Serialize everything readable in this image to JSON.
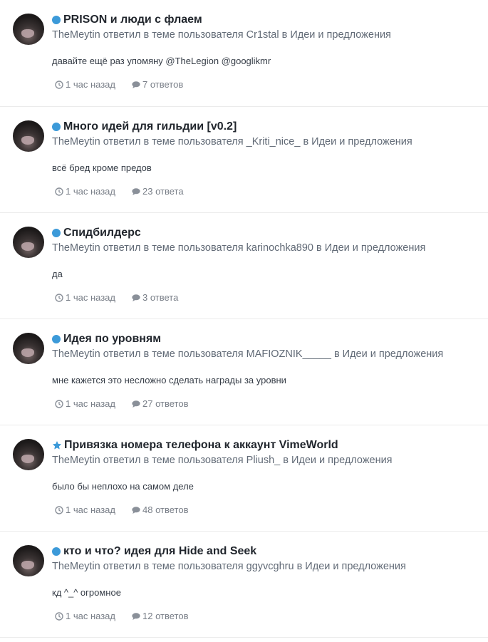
{
  "colors": {
    "unread_dot": "#3c9ad9",
    "title": "#21262d",
    "meta": "#616a76",
    "stats": "#787e87"
  },
  "entries": [
    {
      "marker": "dot",
      "title": "PRISON и люди с флаем",
      "meta": "TheMeytin ответил в теме пользователя Cr1stal в Идеи и предложения",
      "snippet": "давайте ещё раз упомяну @TheLegion @googlikmr",
      "time": "1 час назад",
      "replies": "7 ответов"
    },
    {
      "marker": "dot",
      "title": "Много идей для гильдии [v0.2]",
      "meta": "TheMeytin ответил в теме пользователя _Kriti_nice_ в Идеи и предложения",
      "snippet": "всё бред кроме предов",
      "time": "1 час назад",
      "replies": "23 ответа"
    },
    {
      "marker": "dot",
      "title": "Спидбилдерс",
      "meta": "TheMeytin ответил в теме пользователя karinochka890 в Идеи и предложения",
      "snippet": "да",
      "time": "1 час назад",
      "replies": "3 ответа"
    },
    {
      "marker": "dot",
      "title": "Идея по уровням",
      "meta": "TheMeytin ответил в теме пользователя MAFIOZNIK_____ в Идеи и предложения",
      "snippet": "мне кажется это несложно сделать награды за уровни",
      "time": "1 час назад",
      "replies": "27 ответов"
    },
    {
      "marker": "star",
      "title": "Привязка номера телефона к аккаунт VimeWorld",
      "meta": "TheMeytin ответил в теме пользователя Pliush_ в Идеи и предложения",
      "snippet": "было бы неплохо на самом деле",
      "time": "1 час назад",
      "replies": "48 ответов"
    },
    {
      "marker": "dot",
      "title": "кто и что? идея для Hide and Seek",
      "meta": "TheMeytin ответил в теме пользователя ggyvcghru в Идеи и предложения",
      "snippet": "кд ^_^ огромное",
      "time": "1 час назад",
      "replies": "12 ответов"
    }
  ]
}
